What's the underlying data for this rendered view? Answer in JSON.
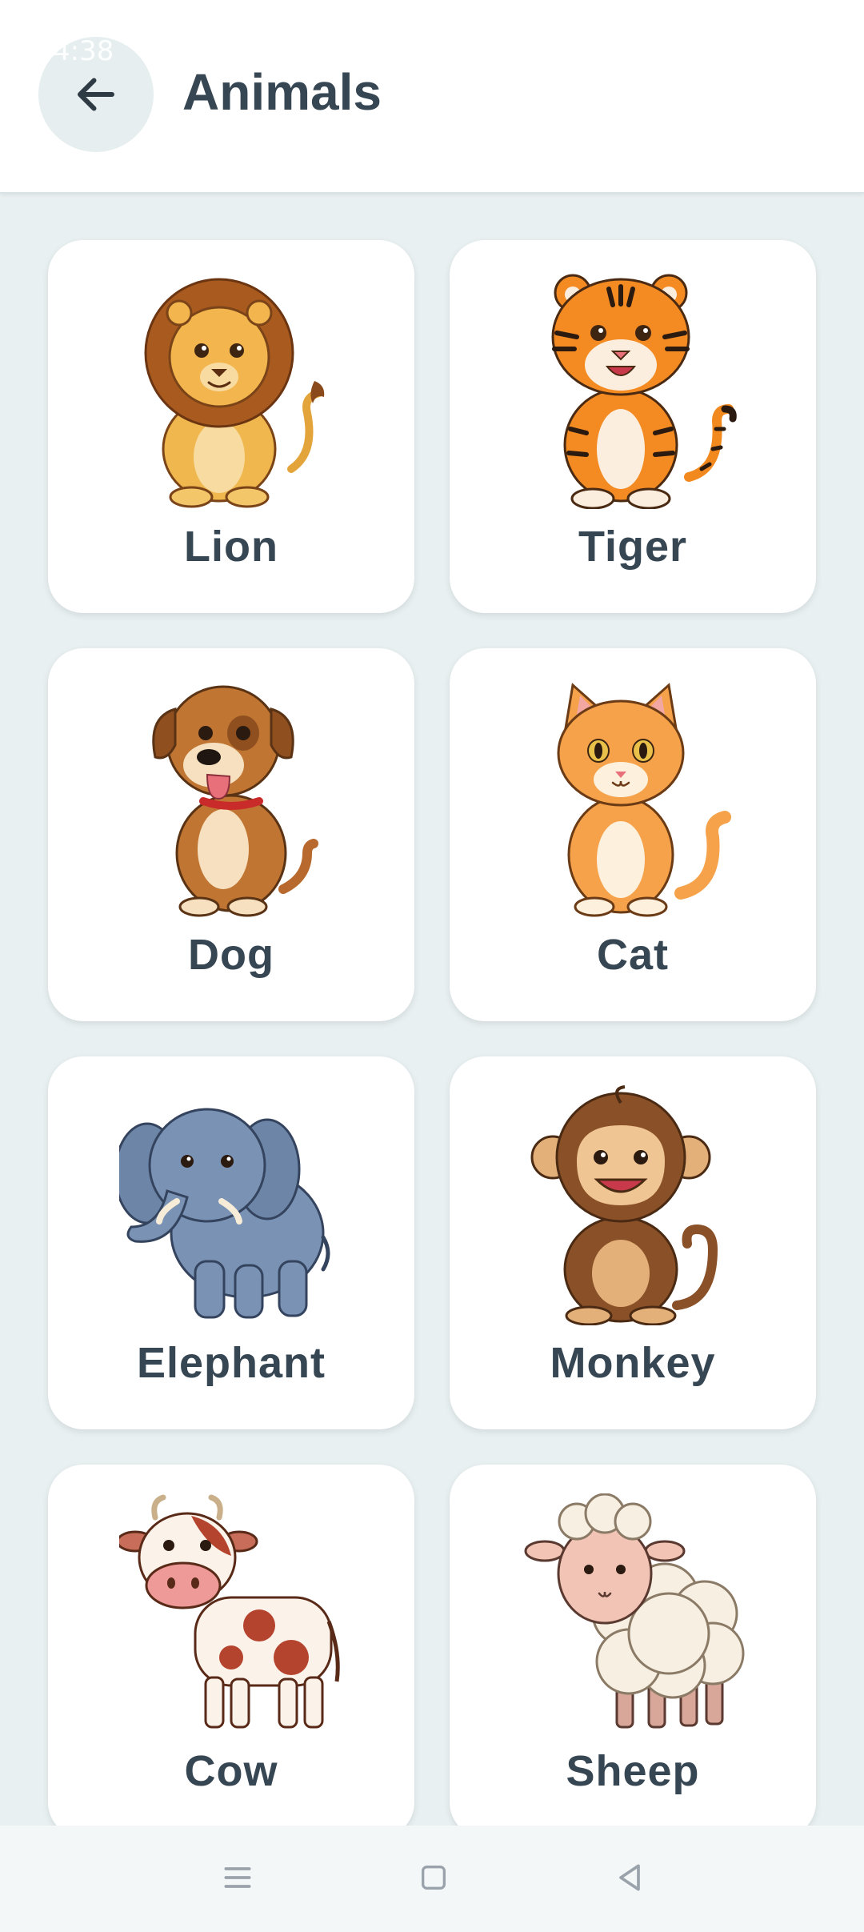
{
  "status_bar": {
    "time": "4:38"
  },
  "header": {
    "title": "Animals",
    "back_icon": "arrow-left-icon"
  },
  "animals": [
    {
      "label": "Lion"
    },
    {
      "label": "Tiger"
    },
    {
      "label": "Dog"
    },
    {
      "label": "Cat"
    },
    {
      "label": "Elephant"
    },
    {
      "label": "Monkey"
    },
    {
      "label": "Cow"
    },
    {
      "label": "Sheep"
    }
  ],
  "navbar": {
    "icons": [
      "menu-icon",
      "home-square-icon",
      "back-triangle-icon"
    ]
  },
  "colors": {
    "background": "#e9f0f1",
    "card": "#ffffff",
    "text": "#364653",
    "back_button": "#e6eeef"
  }
}
